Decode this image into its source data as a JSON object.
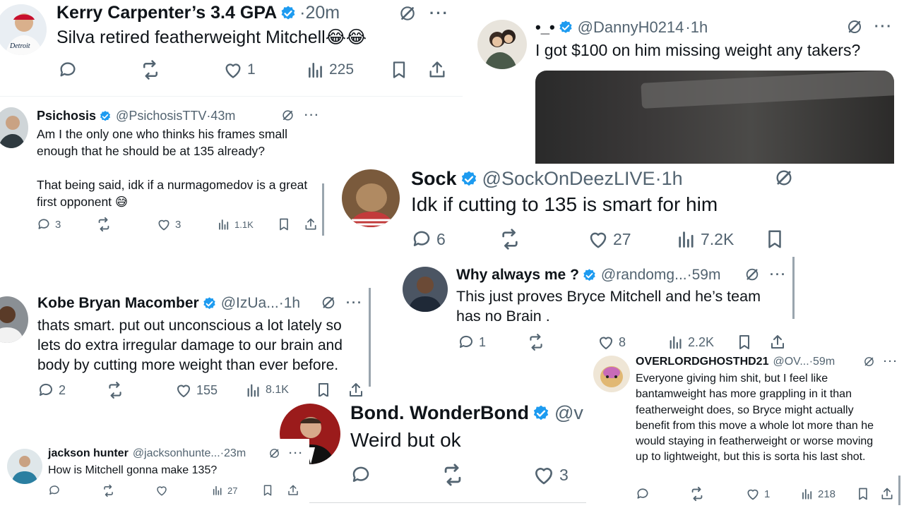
{
  "t1": {
    "name": "Kerry Carpenter’s 3.4 GPA",
    "meta": "·20m",
    "text": "Silva retired featherweight Mitchell😂😂",
    "likes": "1",
    "views": "225"
  },
  "t2": {
    "name": "•_•",
    "handle": "@DannyH0214",
    "meta": "·1h",
    "text": "I got $100 on him missing weight any takers?"
  },
  "t3": {
    "name": "Psichosis",
    "handle": "@PsichosisTTV",
    "meta": "·43m",
    "text1": "Am I the only one who thinks his frames small enough that he should be at 135 already?",
    "text2": "That being said, idk if a nurmagomedov is a great first opponent 😅",
    "replies": "3",
    "likes": "3",
    "views": "1.1K"
  },
  "t4": {
    "name": "Sock",
    "handle": "@SockOnDeezLIVE",
    "meta": "·1h",
    "text": "Idk if cutting to 135 is smart for him",
    "replies": "6",
    "likes": "27",
    "views": "7.2K"
  },
  "t5": {
    "name": "Why always me ?",
    "handle": "@randomg...",
    "meta": "·59m",
    "text": "This just proves Bryce Mitchell and he’s team has no Brain .",
    "replies": "1",
    "likes": "8",
    "views": "2.2K"
  },
  "t6": {
    "name": "Kobe Bryan Macomber",
    "handle": "@IzUa...",
    "meta": "·1h",
    "text": "thats smart. put out unconscious a lot lately so lets do extra irregular damage to our brain and body by cutting more weight than ever before.",
    "replies": "2",
    "likes": "155",
    "views": "8.1K"
  },
  "t7": {
    "name": "OVERLORDGHOSTHD21",
    "handle": "@OV...",
    "meta": "·59m",
    "text": "Everyone giving him shit, but I feel like bantamweight has more grappling in it than featherweight does, so Bryce might actually benefit from this move a whole lot more than he would staying in featherweight or worse moving up to lightweight, but this is sorta his last shot.",
    "likes": "1",
    "views": "218"
  },
  "t8": {
    "name": "Bond. WonderBond",
    "handle": "@v",
    "text": "Weird but ok",
    "likes": "3"
  },
  "t9": {
    "name": "jackson hunter",
    "handle": "@jacksonhunte...",
    "meta": "·23m",
    "text": "How is Mitchell gonna make 135?",
    "views": "27"
  },
  "colors": {
    "verified": "#1d9bf0",
    "text": "#0f1419",
    "muted": "#536471"
  },
  "icons": [
    "reply-icon",
    "retweet-icon",
    "like-icon",
    "views-icon",
    "bookmark-icon",
    "share-icon",
    "grok-icon",
    "more-icon",
    "verified-icon"
  ]
}
